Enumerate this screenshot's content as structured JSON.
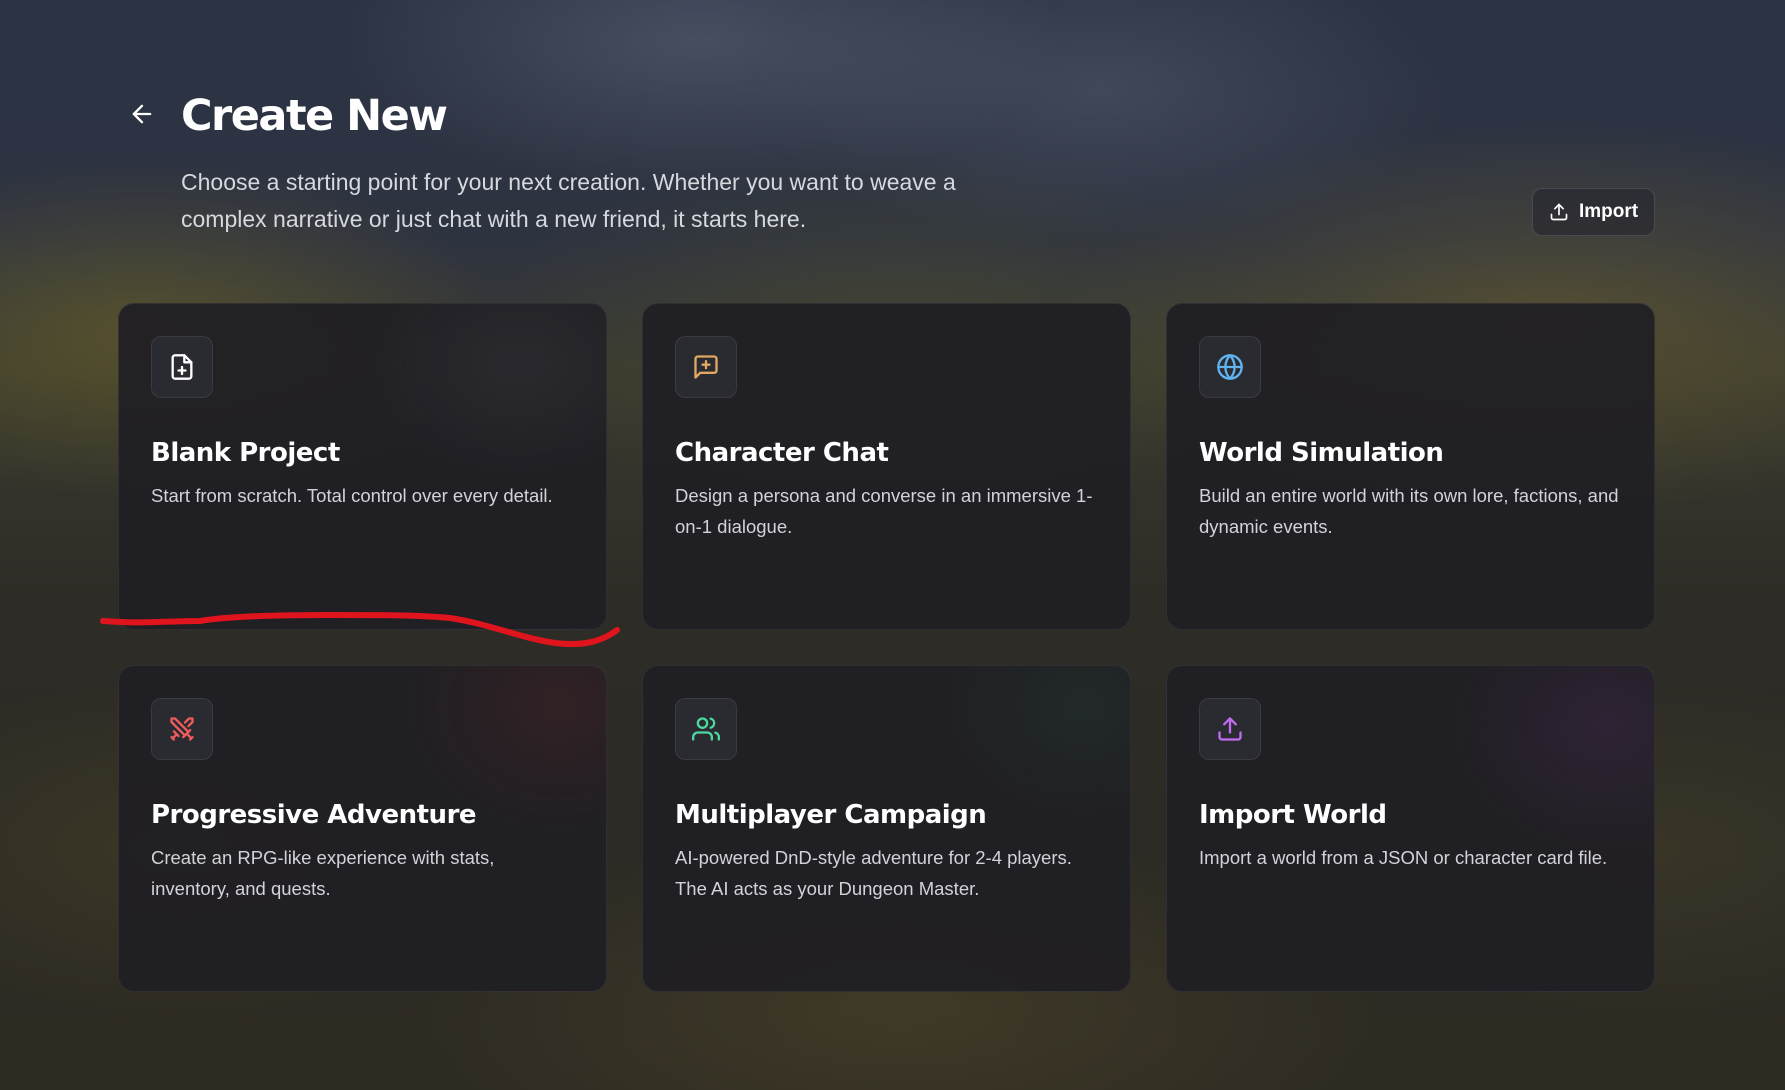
{
  "header": {
    "title": "Create New",
    "subtitle": "Choose a starting point for your next creation. Whether you want to weave a complex narrative or just chat with a new friend, it starts here.",
    "back_icon": "arrow-left-icon",
    "import_button": {
      "label": "Import",
      "icon": "upload-icon"
    }
  },
  "cards": [
    {
      "title": "Blank Project",
      "description": "Start from scratch. Total control over every detail.",
      "icon": "file-plus-icon",
      "icon_color": "#ffffff"
    },
    {
      "title": "Character Chat",
      "description": "Design a persona and converse in an immersive 1-on-1 dialogue.",
      "icon": "message-plus-icon",
      "icon_color": "#e0a860"
    },
    {
      "title": "World Simulation",
      "description": "Build an entire world with its own lore, factions, and dynamic events.",
      "icon": "globe-icon",
      "icon_color": "#5fb3ef"
    },
    {
      "title": "Progressive Adventure",
      "description": "Create an RPG-like experience with stats, inventory, and quests.",
      "icon": "crossed-swords-icon",
      "icon_color": "#ef5b5b"
    },
    {
      "title": "Multiplayer Campaign",
      "description": "AI-powered DnD-style adventure for 2-4 players. The AI acts as your Dungeon Master.",
      "icon": "users-icon",
      "icon_color": "#4cd9a0"
    },
    {
      "title": "Import World",
      "description": "Import a world from a JSON or character card file.",
      "icon": "upload-icon",
      "icon_color": "#c06cf0"
    }
  ],
  "annotation": {
    "type": "red-underline-stroke",
    "color": "#e0141c"
  }
}
